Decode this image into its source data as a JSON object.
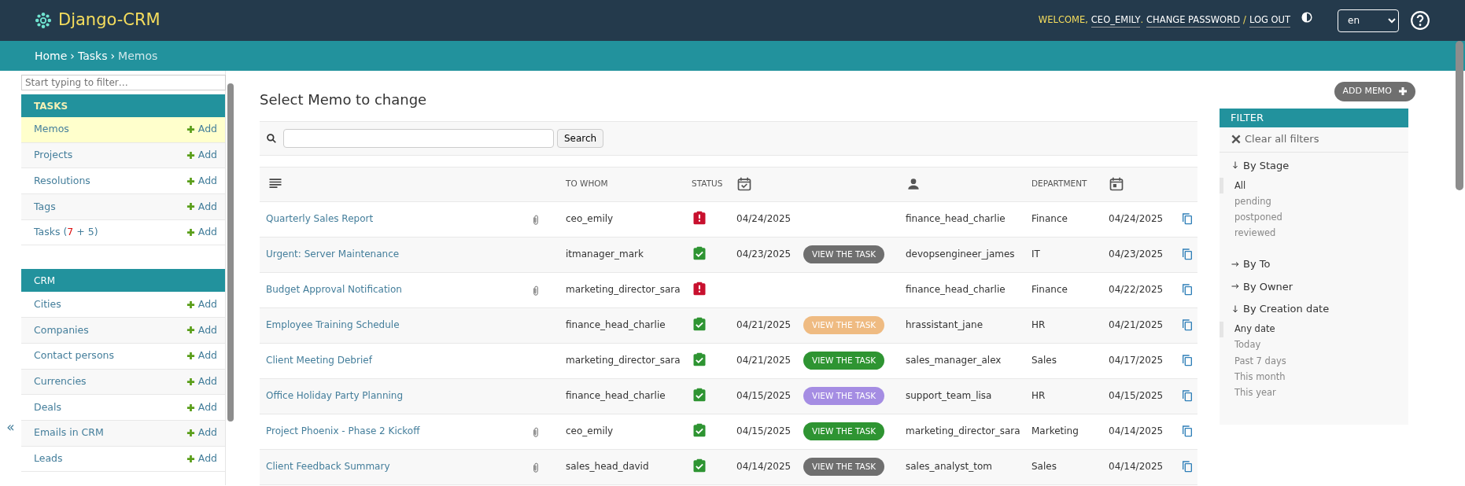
{
  "header": {
    "logo": "Django-CRM",
    "welcome": "WELCOME,",
    "user": "CEO_EMILY",
    "dot": ".",
    "change_password": "CHANGE PASSWORD",
    "separator": "/",
    "logout": "LOG OUT",
    "language": "en"
  },
  "breadcrumbs": {
    "separator": "›",
    "items": [
      {
        "label": "Home",
        "current": false
      },
      {
        "label": "Tasks",
        "current": false
      },
      {
        "label": "Memos",
        "current": true
      }
    ]
  },
  "sidebar": {
    "filter_placeholder": "Start typing to filter…",
    "collapse": "«",
    "sections": [
      {
        "title": "TASKS",
        "selected": true,
        "items": [
          {
            "label": "Memos",
            "add": "Add",
            "selected": true
          },
          {
            "label": "Projects",
            "add": "Add",
            "selected": false
          },
          {
            "label": "Resolutions",
            "add": "Add",
            "selected": false
          },
          {
            "label": "Tags",
            "add": "Add",
            "selected": false
          },
          {
            "label_parts": [
              {
                "text": "Tasks ("
              },
              {
                "text": "7",
                "color": "#dd1111"
              },
              {
                "text": " + 5)"
              }
            ],
            "add": "Add",
            "selected": false
          }
        ]
      },
      {
        "title": "CRM",
        "selected": false,
        "items": [
          {
            "label": "Cities",
            "add": "Add",
            "selected": false
          },
          {
            "label": "Companies",
            "add": "Add",
            "selected": false
          },
          {
            "label": "Contact persons",
            "add": "Add",
            "selected": false
          },
          {
            "label": "Currencies",
            "add": "Add",
            "selected": false
          },
          {
            "label": "Deals",
            "add": "Add",
            "selected": false
          },
          {
            "label": "Emails in CRM",
            "add": "Add",
            "selected": false
          },
          {
            "label": "Leads",
            "add": "Add",
            "selected": false
          }
        ]
      }
    ]
  },
  "page_title": "Select Memo to change",
  "add_button": "ADD MEMO",
  "search": {
    "button": "Search"
  },
  "table": {
    "columns": [
      {
        "kind": "lines-icon"
      },
      {
        "kind": "empty"
      },
      {
        "kind": "text",
        "label": "TO WHOM"
      },
      {
        "kind": "text",
        "label": "STATUS"
      },
      {
        "kind": "calendar-check-icon"
      },
      {
        "kind": "empty"
      },
      {
        "kind": "person-icon"
      },
      {
        "kind": "text",
        "label": "DEPARTMENT"
      },
      {
        "kind": "calendar-icon"
      },
      {
        "kind": "empty"
      }
    ],
    "rows": [
      {
        "title": "Quarterly Sales Report",
        "attachment": true,
        "to_whom": "ceo_emily",
        "status": {
          "kind": "alert"
        },
        "date": "04/24/2025",
        "task_button": null,
        "owner": "finance_head_charlie",
        "department": "Finance",
        "created": "04/24/2025"
      },
      {
        "title": "Urgent: Server Maintenance",
        "attachment": false,
        "to_whom": "itmanager_mark",
        "status": {
          "kind": "done"
        },
        "date": "04/23/2025",
        "task_button": {
          "label": "VIEW THE TASK",
          "color": "#6f6f6f"
        },
        "owner": "devopsengineer_james",
        "department": "IT",
        "created": "04/23/2025"
      },
      {
        "title": "Budget Approval Notification",
        "attachment": true,
        "to_whom": "marketing_director_sara",
        "status": {
          "kind": "alert"
        },
        "task_button": null,
        "owner": "finance_head_charlie",
        "department": "Finance",
        "created": "04/22/2025"
      },
      {
        "title": "Employee Training Schedule",
        "attachment": false,
        "to_whom": "finance_head_charlie",
        "status": {
          "kind": "done"
        },
        "date": "04/21/2025",
        "task_button": {
          "label": "VIEW THE TASK",
          "color": "#efbb82"
        },
        "owner": "hrassistant_jane",
        "department": "HR",
        "created": "04/21/2025"
      },
      {
        "title": "Client Meeting Debrief",
        "attachment": false,
        "to_whom": "marketing_director_sara",
        "status": {
          "kind": "done"
        },
        "date": "04/21/2025",
        "task_button": {
          "label": "VIEW THE TASK",
          "color": "#2e9432"
        },
        "owner": "sales_manager_alex",
        "department": "Sales",
        "created": "04/17/2025"
      },
      {
        "title": "Office Holiday Party Planning",
        "attachment": false,
        "to_whom": "finance_head_charlie",
        "status": {
          "kind": "done"
        },
        "date": "04/15/2025",
        "task_button": {
          "label": "VIEW THE TASK",
          "color": "#a58de3"
        },
        "owner": "support_team_lisa",
        "department": "HR",
        "created": "04/15/2025"
      },
      {
        "title": "Project Phoenix - Phase 2 Kickoff",
        "attachment": true,
        "to_whom": "ceo_emily",
        "status": {
          "kind": "done"
        },
        "date": "04/15/2025",
        "task_button": {
          "label": "VIEW THE TASK",
          "color": "#2e9432"
        },
        "owner": "marketing_director_sara",
        "department": "Marketing",
        "created": "04/14/2025"
      },
      {
        "title": "Client Feedback Summary",
        "attachment": true,
        "to_whom": "sales_head_david",
        "status": {
          "kind": "done"
        },
        "date": "04/14/2025",
        "task_button": {
          "label": "VIEW THE TASK",
          "color": "#6f6f6f"
        },
        "owner": "sales_analyst_tom",
        "department": "Sales",
        "created": "04/14/2025"
      }
    ]
  },
  "filter": {
    "title": "FILTER",
    "clear": "Clear all filters",
    "groups": [
      {
        "heading": "By Stage",
        "expanded": true,
        "options": [
          {
            "label": "All",
            "selected": true
          },
          {
            "label": "pending",
            "selected": false
          },
          {
            "label": "postponed",
            "selected": false
          },
          {
            "label": "reviewed",
            "selected": false
          }
        ]
      },
      {
        "heading": "By To",
        "expanded": false
      },
      {
        "heading": "By Owner",
        "expanded": false
      },
      {
        "heading": "By Creation date",
        "expanded": true,
        "options": [
          {
            "label": "Any date",
            "selected": true
          },
          {
            "label": "Today",
            "selected": false
          },
          {
            "label": "Past 7 days",
            "selected": false
          },
          {
            "label": "This month",
            "selected": false
          },
          {
            "label": "This year",
            "selected": false
          }
        ]
      }
    ]
  }
}
